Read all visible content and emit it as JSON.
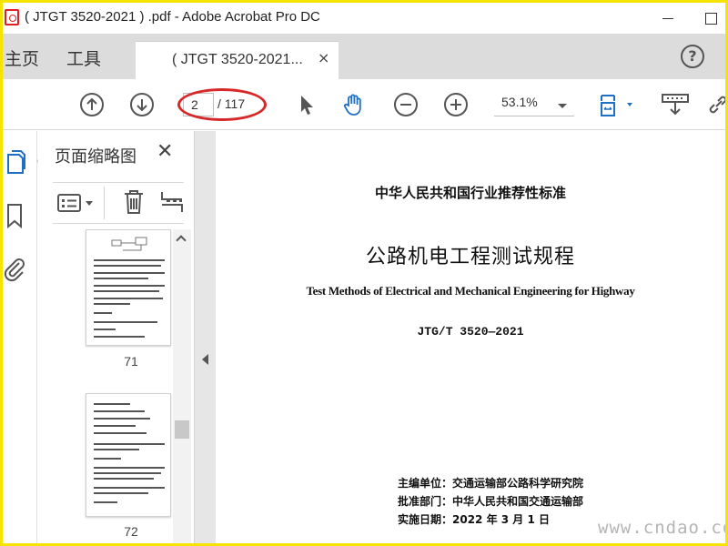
{
  "window": {
    "title": "( JTGT 3520-2021 ) .pdf - Adobe Acrobat Pro DC"
  },
  "tabs": {
    "home": "主页",
    "tools": "工具",
    "document": "( JTGT 3520-2021...",
    "close_glyph": "×",
    "help_glyph": "?"
  },
  "toolbar": {
    "current_page": "2",
    "page_total": "/ 117",
    "zoom": "53.1%"
  },
  "thumbnails_panel": {
    "title": "页面缩略图",
    "close_glyph": "✕",
    "pages": [
      {
        "label": "71"
      },
      {
        "label": "72"
      }
    ]
  },
  "document": {
    "standard_type": "中华人民共和国行业推荐性标准",
    "title_cn": "公路机电工程测试规程",
    "title_en": "Test Methods of Electrical and Mechanical Engineering for Highway",
    "code": "JTG/T 3520—2021",
    "editor": "主编单位：交通运输部公路科学研究院",
    "approver": "批准部门：中华人民共和国交通运输部",
    "effective": "实施日期：2022 年 3 月 1 日"
  },
  "watermark": "www.cndao.com",
  "colors": {
    "frame_border": "#f5e400",
    "highlight": "#d62828",
    "accent_blue": "#1f6fc4"
  },
  "icons": [
    "pdf-app-icon",
    "arrow-up-circle-icon",
    "arrow-down-circle-icon",
    "select-cursor-icon",
    "hand-tool-icon",
    "zoom-out-icon",
    "zoom-in-icon",
    "fit-page-icon",
    "scroll-mode-icon",
    "link-icon",
    "page-thumbnails-icon",
    "bookmark-icon",
    "attachment-icon",
    "options-menu-icon",
    "trash-icon",
    "crop-page-icon"
  ]
}
